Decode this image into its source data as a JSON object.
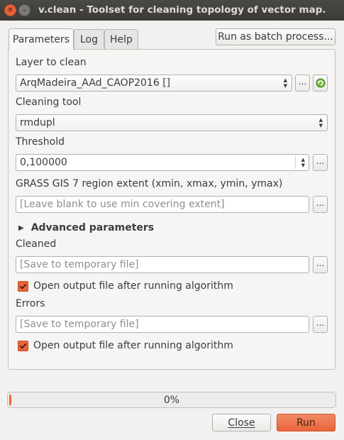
{
  "window": {
    "title": "v.clean - Toolset for cleaning topology of vector map."
  },
  "tabs": [
    {
      "label": "Parameters",
      "active": true
    },
    {
      "label": "Log",
      "active": false
    },
    {
      "label": "Help",
      "active": false
    }
  ],
  "batch_button": "Run as batch process...",
  "params": {
    "layer": {
      "label": "Layer to clean",
      "value": "ArqMadeira_AAd_CAOP2016 []"
    },
    "tool": {
      "label": "Cleaning tool",
      "value": "rmdupl"
    },
    "threshold": {
      "label": "Threshold",
      "value": "0,100000"
    },
    "region": {
      "label": "GRASS GIS 7 region extent (xmin, xmax, ymin, ymax)",
      "placeholder": "[Leave blank to use min covering extent]"
    },
    "advanced": {
      "label": "Advanced parameters",
      "expanded": false
    },
    "cleaned": {
      "label": "Cleaned",
      "placeholder": "[Save to temporary file]",
      "open_label": "Open output file after running algorithm",
      "open_checked": true
    },
    "errors": {
      "label": "Errors",
      "placeholder": "[Save to temporary file]",
      "open_label": "Open output file after running algorithm",
      "open_checked": true
    }
  },
  "ellipsis": "...",
  "progress": {
    "value": 0,
    "text": "0%"
  },
  "buttons": {
    "close": "Close",
    "run": "Run"
  },
  "colors": {
    "accent": "#e9653b",
    "titlebar": "#3c3b37"
  }
}
